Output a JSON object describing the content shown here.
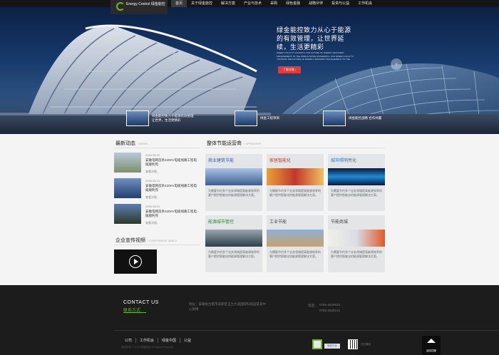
{
  "header": {
    "logo_text": "Energy Control 绿金能控",
    "nav": [
      "首页",
      "关于绿金能控",
      "解决方案",
      "产业与技术",
      "采购",
      "绿色金融",
      "战略伙伴",
      "投资与公益",
      "工作机会"
    ]
  },
  "hero": {
    "title": "绿金能控致力从心于能源的有效管理，让世界延续，生活更精彩",
    "subtitle": "GREEN GOLD TO CONTROL THE FUTURE OF ENERGY EFFICIENT MANAGEMENT TO THE WORLD MORE WONDERFUL LIFE GREEN GOLD TO CONTROL THE FUTURE OF ENERGY EFFICIENT MANAGEMENT TO THE",
    "button": "了解详情 ›",
    "next_icon": "chevron-right-icon",
    "thumbs": [
      {
        "caption": "绿金能控致力于能源有效管理 让世界，生活更精彩"
      },
      {
        "caption": "绿金工程项目"
      },
      {
        "caption": "绿金能控战略 合作共赢"
      }
    ]
  },
  "news": {
    "title": "最新动态",
    "title_en": "/ NEWS",
    "items": [
      {
        "date": "2016-05-11",
        "title": "安徽电网首条220KV电缆线路工程电缆顺利完",
        "more": "查看详细..."
      },
      {
        "date": "2016-05-11",
        "title": "安徽电网首条220KV电缆线路工程电缆顺利完",
        "more": "查看详细..."
      },
      {
        "date": "2016-05-11",
        "title": "安徽电网首条220KV电缆线路工程电缆顺利完",
        "more": "查看详细..."
      }
    ]
  },
  "video": {
    "title": "企业宣传视频",
    "title_en": "/ CORPORATE VIDEO",
    "play_icon": "play-icon"
  },
  "services": {
    "title": "整体节能运营商",
    "title_en": "/ OPERATOR",
    "cards": [
      {
        "title": "商业建筑节能",
        "desc": "为需要节约多个业务领域提高能源效率的客户提供智能化的能源管理解决方案。",
        "color": "#3a5fa8"
      },
      {
        "title": "家居智能化",
        "desc": "为需要节约多个业务领域提高能源效率的客户提供智能化的能源管理解决方案。",
        "color": "#c0392b"
      },
      {
        "title": "城市照明亮化",
        "desc": "为需要节约多个业务领域提高能源效率的客户提供智能化的能源管理解决方案。",
        "color": "#2a7abf"
      },
      {
        "title": "能源城市管控",
        "desc": "为需要节约多个业务领域提高能源效率的客户提供智能化的能源管理解决方案。",
        "color": "#2f8a3a"
      },
      {
        "title": "工业节能",
        "desc": "为需要节约多个业务领域提高能源效率的客户提供智能化的能源管理解决方案。",
        "color": "#444444"
      },
      {
        "title": "节能商城",
        "desc": "为需要节约多个业务领域提高能源效率的客户提供智能化的能源管理解决方案。",
        "color": "#444444"
      }
    ]
  },
  "footer": {
    "contact_en": "CONTACT US",
    "contact_cn": "联系方式",
    "address": "地址：安徽省合肥市高新区玉兰大道国际科技园某某中心某楼",
    "tel_label": "电话：",
    "tel": [
      "0755-3628523",
      "0755-3628113"
    ],
    "links": [
      "公司",
      "工作机会",
      "绿金中国",
      "公益"
    ],
    "copyright": "版权所有 © 2016 绿金能控 All Rights Reserved",
    "badge_label": "电信平台",
    "qr_label": "关注微信",
    "to_top": "返回顶部"
  }
}
